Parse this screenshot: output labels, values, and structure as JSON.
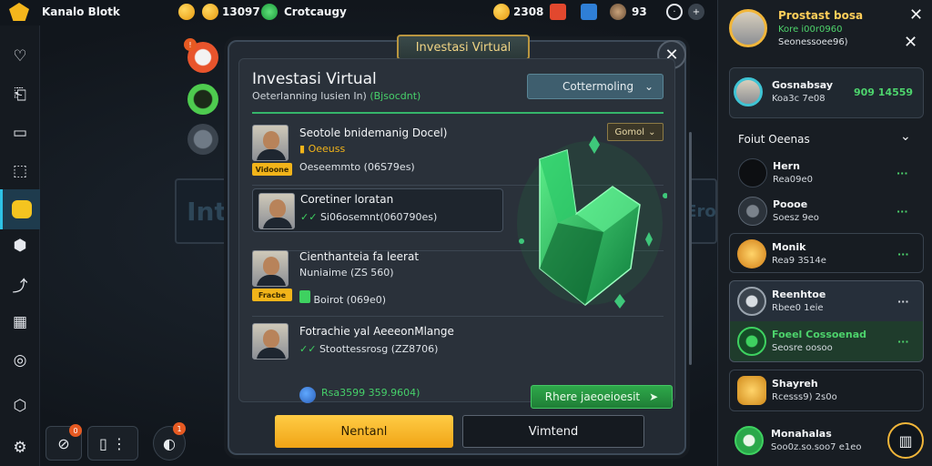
{
  "topbar": {
    "brand": "Kanalo Blotk",
    "coins": "13097",
    "search_label": "Crotcaugy",
    "gold": "2308",
    "gems": "93"
  },
  "sidebar_left": {
    "items": [
      "heart-icon",
      "exit-icon",
      "card-icon",
      "chart-icon",
      "wallet-icon",
      "dice-icon",
      "stairs-icon",
      "grid-icon",
      "globe-icon",
      "shield-icon",
      "settings-icon"
    ]
  },
  "background": {
    "left_panel_text": "Int",
    "right_panel_text": "Ero"
  },
  "modal": {
    "tab_label": "Investasi Virtual",
    "title": "Investasi Virtual",
    "subtitle_main": "Oeterlanning lusien In) ",
    "subtitle_green": "(Bjsocdnt)",
    "category_dropdown": "Cottermoling",
    "filter_dropdown": "Gomol",
    "rows": [
      {
        "name": "Seotole bnidemanig Docel)",
        "sub": "Oeeuss",
        "sub2": "Oeseemmto (06S79es)",
        "badge": "Vidoone"
      },
      {
        "name": "Coretiner loratan",
        "sub": "Si06osemnt(060790es)",
        "badge": ""
      },
      {
        "name": "Cienthanteia fa leerat",
        "sub": "Nuniaime (ZS 560)",
        "sub2": "Boirot (069e0)",
        "badge": "Fracbe"
      },
      {
        "name": "Fotrachie yal AeeeonMlange",
        "sub": "Stoottessrosg (ZZ8706)",
        "badge": ""
      }
    ],
    "earn_text": "Rsa3599 359.9604)",
    "green_button": "Rhere jaeoeioesit",
    "btn_primary": "Nentanl",
    "btn_secondary": "Vimtend"
  },
  "sidebar_right": {
    "profile_title": "Prostast bosa",
    "profile_sub_green": "Kore i00r0960",
    "profile_sub": "Seonessoee96)",
    "featured_name": "Gosnabsay",
    "featured_val": "Koa3c 7e08",
    "featured_green": "909 14559",
    "section_title": "Foiut Oeenas",
    "items": [
      {
        "name": "Hern",
        "val": "Rea09e0"
      },
      {
        "name": "Poooe",
        "val": "Soesz 9eo"
      },
      {
        "name": "Monik",
        "val": "Rea9 3S14e"
      },
      {
        "name": "Reenhtoe",
        "val": "Rbee0 1eie"
      },
      {
        "name": "Foeel Cossoenad",
        "val": "Seosre oosoo"
      },
      {
        "name": "Shayreh",
        "val": "Rcesss9) 2s0o"
      },
      {
        "name": "Monahalas",
        "val": "Soo0z.so.soo7 e1eo"
      }
    ]
  },
  "colors": {
    "accent_green": "#3ed160",
    "accent_gold": "#f2b41a",
    "highlight_cyan": "#2ec2e6"
  }
}
